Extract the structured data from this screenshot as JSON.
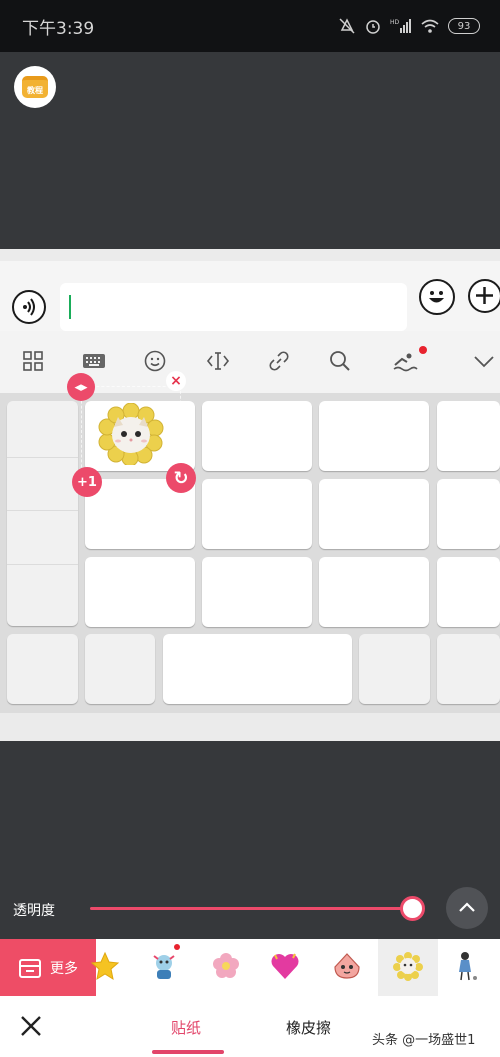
{
  "status_bar": {
    "time": "下午3:39",
    "battery": "93",
    "network": "HD"
  },
  "badge": {
    "label": "教程"
  },
  "input": {
    "value": ""
  },
  "toolbar": {
    "icons": [
      "grid-icon",
      "keyboard-icon",
      "smiley-icon",
      "cursor-move-icon",
      "link-icon",
      "search-icon",
      "swimmer-icon",
      "chevron-down-icon"
    ]
  },
  "sticker_controls": {
    "mirror": "◂▸",
    "plus_one": "+1",
    "rotate": "↻",
    "delete": "×"
  },
  "opacity": {
    "label": "透明度",
    "value_fraction": 0.97
  },
  "sticker_bar": {
    "more_label": "更多",
    "items": [
      "star-sticker",
      "character-sticker",
      "flower-sticker",
      "heart-sticker",
      "bird-sticker",
      "cat-flower-sticker",
      "girl-sticker"
    ],
    "selected_index": 5
  },
  "tabs": {
    "sticker": "贴纸",
    "eraser": "橡皮擦",
    "active": "贴纸"
  },
  "watermark": "头条 @一场盛世1",
  "colors": {
    "accent": "#ec4a6a",
    "more_button": "#ee4d66",
    "cursor": "#1aad5a",
    "background": "#36383b"
  }
}
